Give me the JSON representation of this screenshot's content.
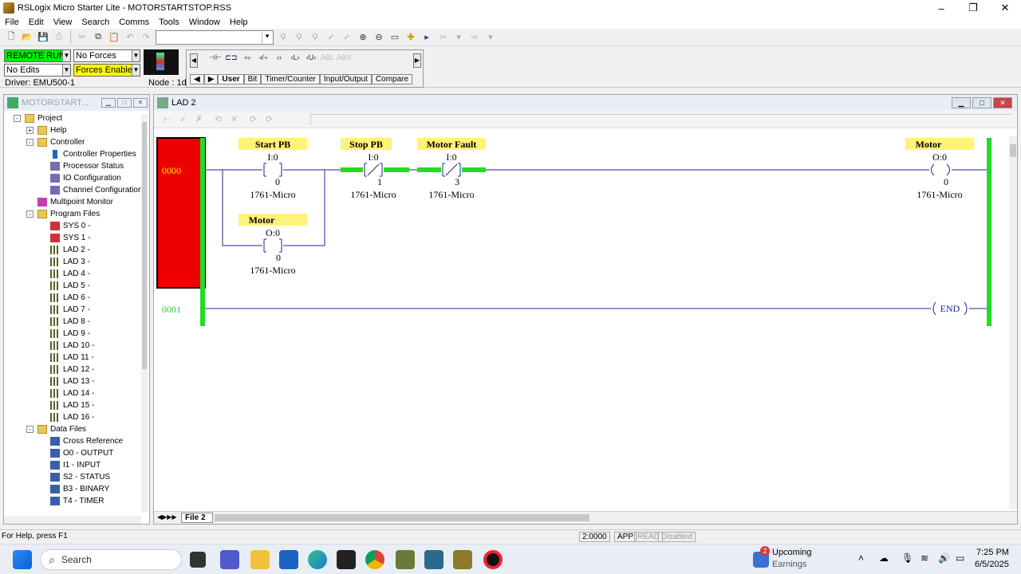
{
  "window": {
    "title": "RSLogix Micro Starter Lite - MOTORSTARTSTOP.RSS",
    "controls": [
      "–",
      "❐",
      "✕"
    ]
  },
  "menu": [
    "File",
    "Edit",
    "View",
    "Search",
    "Comms",
    "Tools",
    "Window",
    "Help"
  ],
  "status_panel": {
    "mode": "REMOTE RUN",
    "forces": "No Forces",
    "edits": "No Edits",
    "forces_enabled": "Forces Enabled",
    "driver": "Driver: EMU500-1",
    "node": "Node :  1d"
  },
  "instruction_bar": {
    "tabs": [
      "User",
      "Bit",
      "Timer/Counter",
      "Input/Output",
      "Compare"
    ],
    "active_tab": "User"
  },
  "project_window": {
    "title": "MOTORSTART...",
    "items": [
      {
        "label": "Project",
        "level": 0,
        "icon": "folder",
        "expand": "-"
      },
      {
        "label": "Help",
        "level": 1,
        "icon": "folder",
        "expand": "+"
      },
      {
        "label": "Controller",
        "level": 1,
        "icon": "folder",
        "expand": "-"
      },
      {
        "label": "Controller Properties",
        "level": 2,
        "icon": "info"
      },
      {
        "label": "Processor Status",
        "level": 2,
        "icon": "gen"
      },
      {
        "label": "IO Configuration",
        "level": 2,
        "icon": "gen"
      },
      {
        "label": "Channel Configuration",
        "level": 2,
        "icon": "gen"
      },
      {
        "label": "Multipoint Monitor",
        "level": 1,
        "icon": "pink"
      },
      {
        "label": "Program Files",
        "level": 1,
        "icon": "folder",
        "expand": "-"
      },
      {
        "label": "SYS 0 -",
        "level": 2,
        "icon": "sys"
      },
      {
        "label": "SYS 1 -",
        "level": 2,
        "icon": "sys"
      },
      {
        "label": "LAD 2 -",
        "level": 2,
        "icon": "ladder"
      },
      {
        "label": "LAD 3 -",
        "level": 2,
        "icon": "ladder"
      },
      {
        "label": "LAD 4 -",
        "level": 2,
        "icon": "ladder"
      },
      {
        "label": "LAD 5 -",
        "level": 2,
        "icon": "ladder"
      },
      {
        "label": "LAD 6 -",
        "level": 2,
        "icon": "ladder"
      },
      {
        "label": "LAD 7 -",
        "level": 2,
        "icon": "ladder"
      },
      {
        "label": "LAD 8 -",
        "level": 2,
        "icon": "ladder"
      },
      {
        "label": "LAD 9 -",
        "level": 2,
        "icon": "ladder"
      },
      {
        "label": "LAD 10 -",
        "level": 2,
        "icon": "ladder"
      },
      {
        "label": "LAD 11 -",
        "level": 2,
        "icon": "ladder"
      },
      {
        "label": "LAD 12 -",
        "level": 2,
        "icon": "ladder"
      },
      {
        "label": "LAD 13 -",
        "level": 2,
        "icon": "ladder"
      },
      {
        "label": "LAD 14 -",
        "level": 2,
        "icon": "ladder"
      },
      {
        "label": "LAD 15 -",
        "level": 2,
        "icon": "ladder"
      },
      {
        "label": "LAD 16 -",
        "level": 2,
        "icon": "ladder"
      },
      {
        "label": "Data Files",
        "level": 1,
        "icon": "folder",
        "expand": "-"
      },
      {
        "label": "Cross Reference",
        "level": 2,
        "icon": "file"
      },
      {
        "label": "O0 - OUTPUT",
        "level": 2,
        "icon": "file"
      },
      {
        "label": "I1 - INPUT",
        "level": 2,
        "icon": "file"
      },
      {
        "label": "S2 - STATUS",
        "level": 2,
        "icon": "file"
      },
      {
        "label": "B3 - BINARY",
        "level": 2,
        "icon": "file"
      },
      {
        "label": "T4 - TIMER",
        "level": 2,
        "icon": "file"
      }
    ]
  },
  "ladder_window": {
    "title": "LAD 2",
    "file_tab": "File 2",
    "rungs": [
      {
        "number": "0000",
        "elements": [
          {
            "description": "Start PB",
            "address": "I:0",
            "bit": "0",
            "module": "1761-Micro",
            "type": "XIC"
          },
          {
            "description": "Stop PB",
            "address": "I:0",
            "bit": "1",
            "module": "1761-Micro",
            "type": "XIO"
          },
          {
            "description": "Motor Fault",
            "address": "I:0",
            "bit": "3",
            "module": "1761-Micro",
            "type": "XIO"
          },
          {
            "description": "Motor",
            "address": "O:0",
            "bit": "0",
            "module": "1761-Micro",
            "type": "OTE"
          },
          {
            "description": "Motor",
            "address": "O:0",
            "bit": "0",
            "module": "1761-Micro",
            "type": "XIC-branch"
          }
        ]
      },
      {
        "number": "0001",
        "end_label": "END"
      }
    ]
  },
  "status_bar": {
    "help": "For Help, press F1",
    "position": "2:0000",
    "app": "APP",
    "read": "READ",
    "disabled": "Disabled"
  },
  "taskbar": {
    "search": "Search",
    "weather_title": "Upcoming",
    "weather_sub": "Earnings",
    "notif_count": "2",
    "time": "7:25 PM",
    "date": "6/5/2025"
  },
  "colors": {
    "rail_green": "#22dd22",
    "rung_red": "#ee0000",
    "label_yellow": "#fff27a",
    "rung_number_green": "#33cc33",
    "wire_blue": "#1b2a8c",
    "run_green": "#00ee00"
  }
}
